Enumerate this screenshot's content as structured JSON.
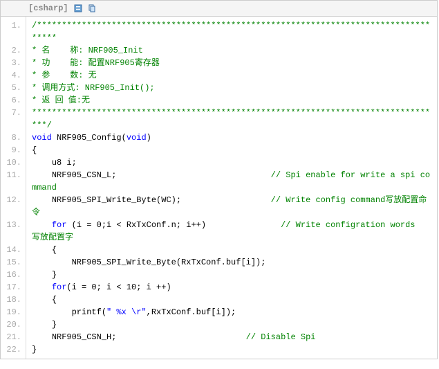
{
  "header": {
    "language": "[csharp]",
    "icon1": "view-plain-icon",
    "icon2": "copy-icon"
  },
  "code": {
    "line1": "/************************************************************************************",
    "line2": "* 名    称: NRF905_Init",
    "line3": "* 功    能: 配置NRF905寄存器",
    "line4": "* 参    数: 无",
    "line5": "* 调用方式: NRF905_Init();",
    "line6": "* 返 回 值:无",
    "line7": "***********************************************************************************/",
    "kw_void": "void",
    "fn_name": " NRF905_Config(",
    "kw_void2": "void",
    "fn_close": ")  ",
    "brace_open": "{  ",
    "l10": "    u8 i;  ",
    "l11a": "    NRF905_CSN_L;                               ",
    "l11c": "// Spi enable for write a spi command  ",
    "l12a": "    NRF905_SPI_Write_Byte(WC);                  ",
    "l12c": "// Write config command写放配置命令  ",
    "kw_for": "for",
    "l13a": "    ",
    "l13b": " (i = 0;i < RxTxConf.n; i++)               ",
    "l13c": "// Write configration words  写放配置字  ",
    "l14": "    {  ",
    "l15": "        NRF905_SPI_Write_Byte(RxTxConf.buf[i]);  ",
    "l16": "    }  ",
    "l17a": "    ",
    "l17b": "(i = 0; i < 10; i ++)  ",
    "l18": "    {  ",
    "l19a": "        printf(",
    "l19s": "\" %x \\r\"",
    "l19b": ",RxTxConf.buf[i]);  ",
    "l20": "    }  ",
    "l21a": "    NRF905_CSN_H;                          ",
    "l21c": "// Disable Spi  ",
    "l22": "}  "
  },
  "line_numbers": [
    "1.",
    "2.",
    "3.",
    "4.",
    "5.",
    "6.",
    "7.",
    "8.",
    "9.",
    "10.",
    "11.",
    "12.",
    "13.",
    "14.",
    "15.",
    "16.",
    "17.",
    "18.",
    "19.",
    "20.",
    "21.",
    "22."
  ]
}
